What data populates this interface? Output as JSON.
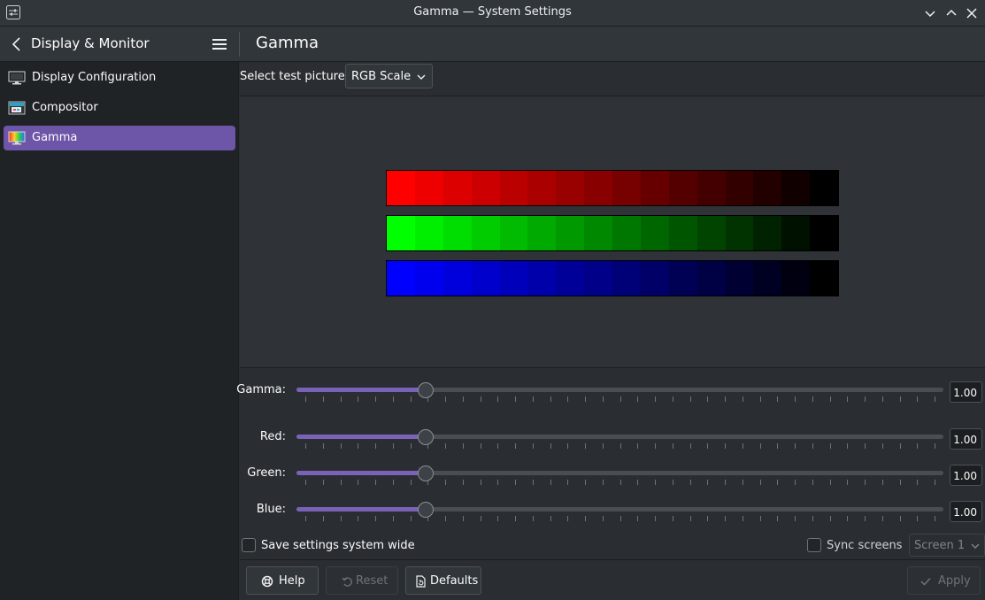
{
  "window": {
    "title": "Gamma — System Settings"
  },
  "header": {
    "breadcrumb": "Display & Monitor",
    "page_title": "Gamma"
  },
  "sidebar": {
    "items": [
      {
        "label": "Display Configuration",
        "icon": "monitor-icon",
        "active": false
      },
      {
        "label": "Compositor",
        "icon": "compositor-icon",
        "active": false
      },
      {
        "label": "Gamma",
        "icon": "gamma-icon",
        "active": true
      }
    ]
  },
  "test_picture": {
    "label": "Select test picture:",
    "selected": "RGB Scale"
  },
  "sliders": {
    "gamma": {
      "label": "Gamma:",
      "value": "1.00",
      "fraction": 0.2
    },
    "red": {
      "label": "Red:",
      "value": "1.00",
      "fraction": 0.2
    },
    "green": {
      "label": "Green:",
      "value": "1.00",
      "fraction": 0.2
    },
    "blue": {
      "label": "Blue:",
      "value": "1.00",
      "fraction": 0.2
    }
  },
  "options": {
    "save_system_wide": {
      "label": "Save settings system wide",
      "checked": false
    },
    "sync_screens": {
      "label": "Sync screens",
      "checked": false
    },
    "screen_select": "Screen 1"
  },
  "buttons": {
    "help": "Help",
    "reset": "Reset",
    "defaults": "Defaults",
    "apply": "Apply"
  },
  "colors": {
    "accent": "#6d55a8",
    "red_bar": "#ff0000",
    "green_bar": "#00ff00",
    "blue_bar": "#0000ff"
  }
}
